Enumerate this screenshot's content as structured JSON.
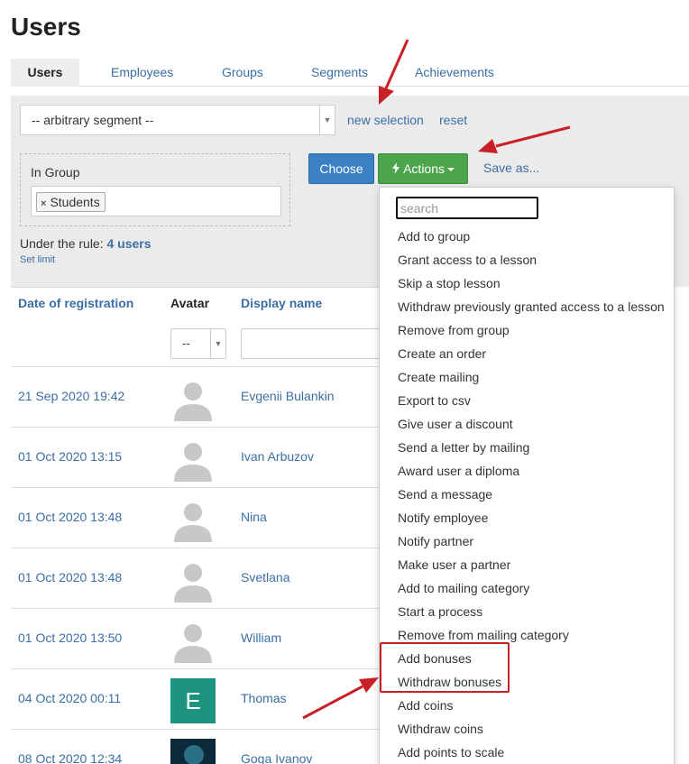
{
  "page": {
    "title": "Users"
  },
  "tabs": [
    {
      "label": "Users",
      "active": true
    },
    {
      "label": "Employees",
      "active": false
    },
    {
      "label": "Groups",
      "active": false
    },
    {
      "label": "Segments",
      "active": false
    },
    {
      "label": "Achievements",
      "active": false
    }
  ],
  "filter": {
    "segment_select": "-- arbitrary segment --",
    "new_selection": "new selection",
    "reset": "reset",
    "group_label": "In Group",
    "group_chip": "Students",
    "rule_prefix": "Under the rule:",
    "rule_count": "4 users",
    "set_limit": "Set limit"
  },
  "buttons": {
    "choose": "Choose",
    "actions": "Actions",
    "save_as": "Save as..."
  },
  "table": {
    "headers": {
      "date": "Date of registration",
      "avatar": "Avatar",
      "name": "Display name"
    },
    "avatar_filter": "--",
    "rows": [
      {
        "date": "21 Sep 2020 19:42",
        "name": "Evgenii Bulankin"
      },
      {
        "date": "01 Oct 2020 13:15",
        "name": "Ivan Arbuzov"
      },
      {
        "date": "01 Oct 2020 13:48",
        "name": "Nina"
      },
      {
        "date": "01 Oct 2020 13:48",
        "name": "Svetlana"
      },
      {
        "date": "01 Oct 2020 13:50",
        "name": "William"
      },
      {
        "date": "04 Oct 2020 00:11",
        "name": "Thomas",
        "initial": "E"
      },
      {
        "date": "08 Oct 2020 12:34",
        "name": "Goga Ivanov"
      }
    ]
  },
  "actions_menu": {
    "search_placeholder": "search",
    "items": [
      "Add to group",
      "Grant access to a lesson",
      "Skip a stop lesson",
      "Withdraw previously granted access to a lesson",
      "Remove from group",
      "Create an order",
      "Create mailing",
      "Export to csv",
      "Give user a discount",
      "Send a letter by mailing",
      "Award user a diploma",
      "Send a message",
      "Notify employee",
      "Notify partner",
      "Make user a partner",
      "Add to mailing category",
      "Start a process",
      "Remove from mailing category",
      "Add bonuses",
      "Withdraw bonuses",
      "Add coins",
      "Withdraw coins",
      "Add points to scale"
    ]
  },
  "colors": {
    "link": "#3a6ea5",
    "choose_button": "#3b7fc4",
    "actions_button": "#4ca54c",
    "annotation": "#c92027"
  },
  "icons": {
    "actions_button": "lightning-icon",
    "avatar_placeholder": "user-silhouette-icon"
  }
}
